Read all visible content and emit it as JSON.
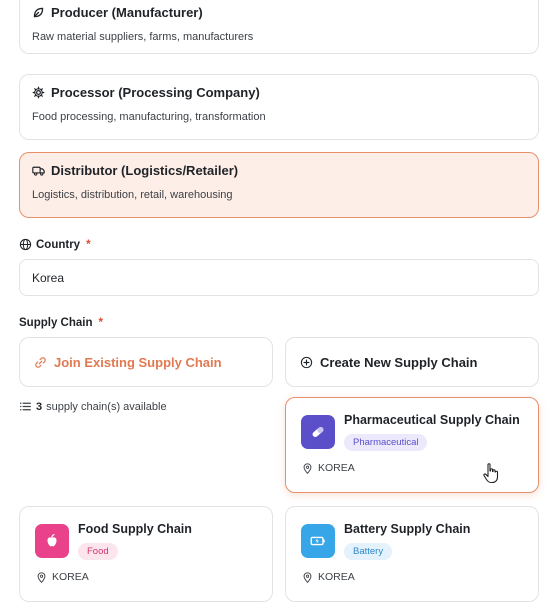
{
  "roles": [
    {
      "title": "Producer (Manufacturer)",
      "desc": "Raw material suppliers, farms, manufacturers",
      "icon": "leaf-icon"
    },
    {
      "title": "Processor (Processing Company)",
      "desc": "Food processing, manufacturing, transformation",
      "icon": "gear-icon"
    },
    {
      "title": "Distributor (Logistics/Retailer)",
      "desc": "Logistics, distribution, retail, warehousing",
      "icon": "truck-icon",
      "selected": true
    }
  ],
  "country": {
    "label": "Country",
    "required_mark": "*",
    "value": "Korea",
    "icon": "globe-icon"
  },
  "supply_chain": {
    "label": "Supply Chain",
    "required_mark": "*",
    "join_label": "Join Existing Supply Chain",
    "create_label": "Create New Supply Chain",
    "available_count": "3",
    "available_text": "supply chain(s) available"
  },
  "chains": [
    {
      "name": "Pharmaceutical Supply Chain",
      "tag": "Pharmaceutical",
      "location": "KOREA",
      "icon": "pill-icon",
      "colors": {
        "logo": "#5a4fc9",
        "tag_bg": "#ebe9fb",
        "tag_text": "#5a4fc9"
      }
    },
    {
      "name": "Food Supply Chain",
      "tag": "Food",
      "location": "KOREA",
      "icon": "apple-icon",
      "colors": {
        "logo": "#e9418a",
        "tag_bg": "#fde5ee",
        "tag_text": "#d2336f"
      }
    },
    {
      "name": "Battery Supply Chain",
      "tag": "Battery",
      "location": "KOREA",
      "icon": "battery-icon",
      "colors": {
        "logo": "#36a6e8",
        "tag_bg": "#e3f2fc",
        "tag_text": "#2f88c9"
      }
    }
  ],
  "colors": {
    "accent": "#e17a52",
    "accent_border": "#e8906c",
    "selected_bg": "#fdeee7",
    "required": "#e0492f"
  }
}
